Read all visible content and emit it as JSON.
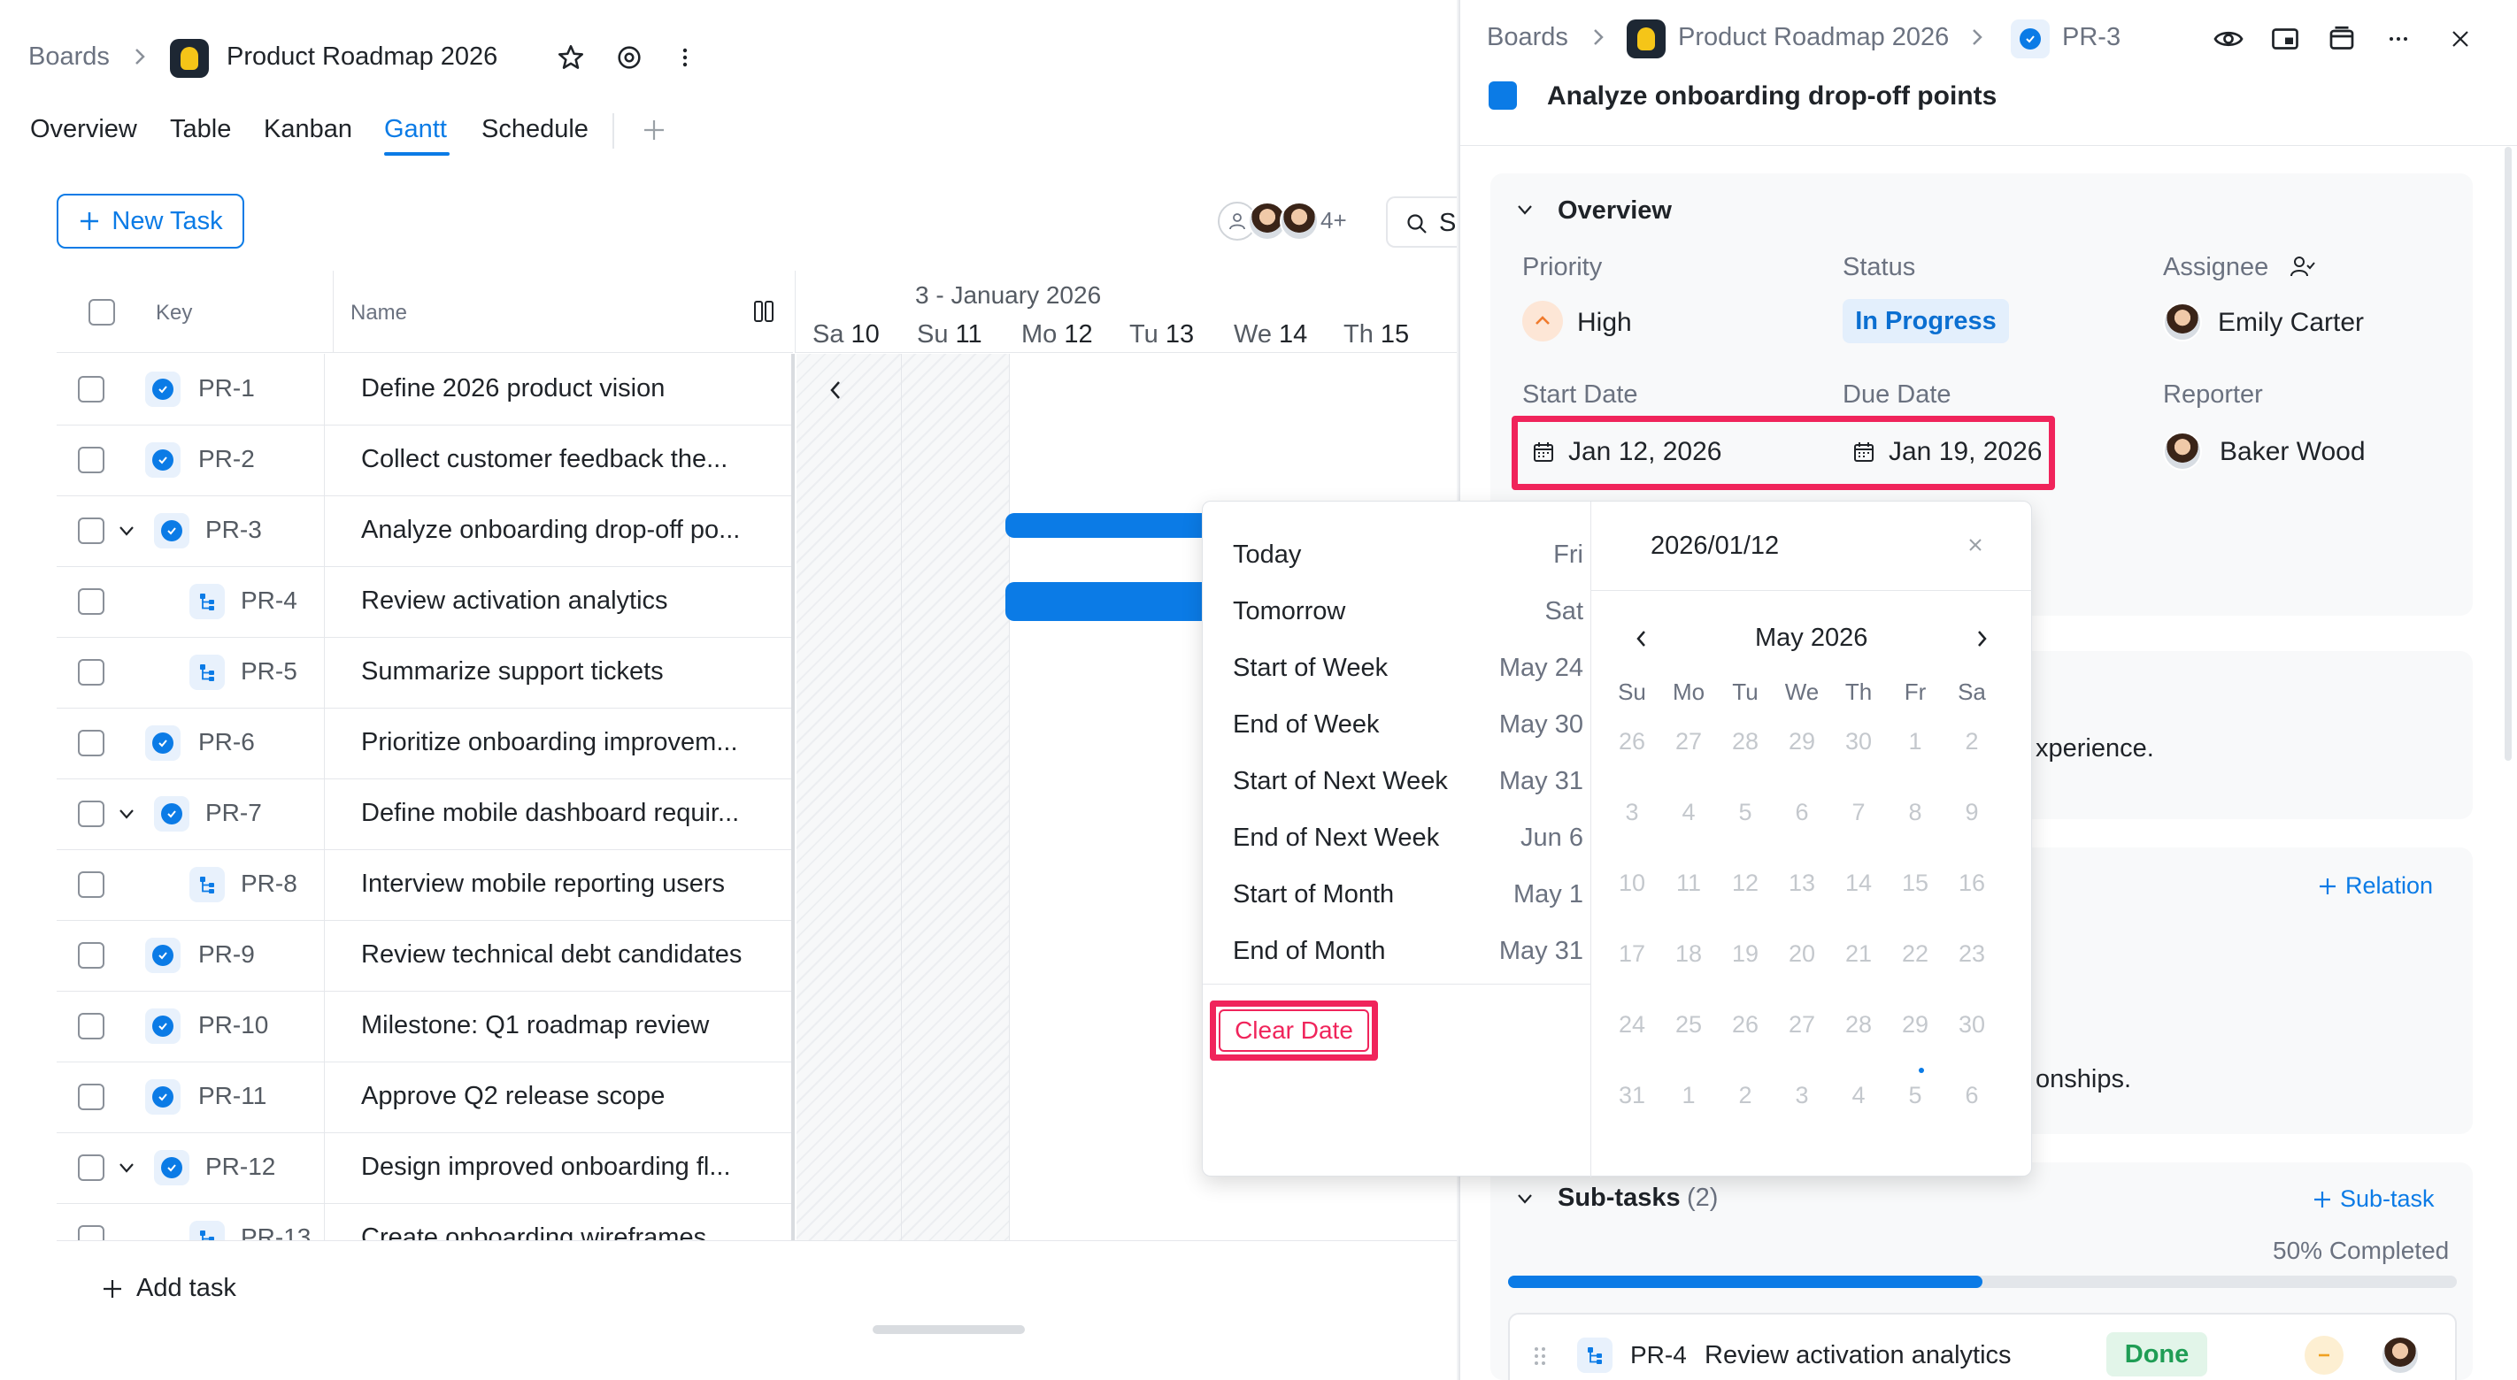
{
  "breadcrumb": {
    "boards": "Boards",
    "project": "Product Roadmap 2026",
    "task_key": "PR-3"
  },
  "tabs": [
    "Overview",
    "Table",
    "Kanban",
    "Gantt",
    "Schedule"
  ],
  "active_tab": "Gantt",
  "toolbar": {
    "new_task": "New Task",
    "members_more": "4+",
    "search_partial": "S"
  },
  "table": {
    "headers": {
      "key": "Key",
      "name": "Name"
    },
    "rows": [
      {
        "key": "PR-1",
        "name": "Define 2026 product vision",
        "type": "task",
        "expandable": false
      },
      {
        "key": "PR-2",
        "name": "Collect customer feedback the...",
        "type": "task",
        "expandable": false
      },
      {
        "key": "PR-3",
        "name": "Analyze onboarding drop-off po...",
        "type": "task",
        "expandable": true
      },
      {
        "key": "PR-4",
        "name": "Review activation analytics",
        "type": "subtask",
        "expandable": false
      },
      {
        "key": "PR-5",
        "name": "Summarize support tickets",
        "type": "subtask",
        "expandable": false
      },
      {
        "key": "PR-6",
        "name": "Prioritize onboarding improvem...",
        "type": "task",
        "expandable": false
      },
      {
        "key": "PR-7",
        "name": "Define mobile dashboard requir...",
        "type": "task",
        "expandable": true
      },
      {
        "key": "PR-8",
        "name": "Interview mobile reporting users",
        "type": "subtask",
        "expandable": false
      },
      {
        "key": "PR-9",
        "name": "Review technical debt candidates",
        "type": "task",
        "expandable": false
      },
      {
        "key": "PR-10",
        "name": "Milestone: Q1 roadmap review",
        "type": "task",
        "expandable": false
      },
      {
        "key": "PR-11",
        "name": "Approve Q2 release scope",
        "type": "task",
        "expandable": false
      },
      {
        "key": "PR-12",
        "name": "Design improved onboarding fl...",
        "type": "task",
        "expandable": true
      },
      {
        "key": "PR-13",
        "name": "Create onboarding wireframes",
        "type": "subtask",
        "expandable": false
      }
    ],
    "add_task": "Add task"
  },
  "gantt": {
    "week_label": "3 - January 2026",
    "days": [
      {
        "dow": "Sa",
        "num": "10"
      },
      {
        "dow": "Su",
        "num": "11"
      },
      {
        "dow": "Mo",
        "num": "12"
      },
      {
        "dow": "Tu",
        "num": "13"
      },
      {
        "dow": "We",
        "num": "14"
      },
      {
        "dow": "Th",
        "num": "15"
      }
    ]
  },
  "detail": {
    "title": "Analyze onboarding drop-off points",
    "overview_label": "Overview",
    "priority_label": "Priority",
    "priority_value": "High",
    "status_label": "Status",
    "status_value": "In Progress",
    "assignee_label": "Assignee",
    "assignee_value": "Emily Carter",
    "start_label": "Start Date",
    "start_value": "Jan 12, 2026",
    "due_label": "Due Date",
    "due_value": "Jan 19, 2026",
    "reporter_label": "Reporter",
    "reporter_value": "Baker Wood",
    "desc_fragment": "xperience.",
    "relation_button": "Relation",
    "relations_fragment": "onships.",
    "subtasks_label": "Sub-tasks",
    "subtasks_count": "(2)",
    "subtask_add": "Sub-task",
    "progress_text": "50% Completed",
    "progress": 0.5,
    "subtask_row": {
      "key": "PR-4",
      "name": "Review activation analytics",
      "status": "Done"
    }
  },
  "date_picker": {
    "input_value": "2026/01/12",
    "month_label": "May 2026",
    "clear_label": "Clear Date",
    "quick": [
      {
        "label": "Today",
        "value": "Fri"
      },
      {
        "label": "Tomorrow",
        "value": "Sat"
      },
      {
        "label": "Start of Week",
        "value": "May 24"
      },
      {
        "label": "End of Week",
        "value": "May 30"
      },
      {
        "label": "Start of Next Week",
        "value": "May 31"
      },
      {
        "label": "End of Next Week",
        "value": "Jun 6"
      },
      {
        "label": "Start of Month",
        "value": "May 1"
      },
      {
        "label": "End of Month",
        "value": "May 31"
      }
    ],
    "weekdays": [
      "Su",
      "Mo",
      "Tu",
      "We",
      "Th",
      "Fr",
      "Sa"
    ],
    "weeks": [
      [
        "26",
        "27",
        "28",
        "29",
        "30",
        "1",
        "2"
      ],
      [
        "3",
        "4",
        "5",
        "6",
        "7",
        "8",
        "9"
      ],
      [
        "10",
        "11",
        "12",
        "13",
        "14",
        "15",
        "16"
      ],
      [
        "17",
        "18",
        "19",
        "20",
        "21",
        "22",
        "23"
      ],
      [
        "24",
        "25",
        "26",
        "27",
        "28",
        "29",
        "30"
      ],
      [
        "31",
        "1",
        "2",
        "3",
        "4",
        "5",
        "6"
      ]
    ]
  },
  "colors": {
    "accent": "#0b7be6",
    "highlight": "#f0245b",
    "done_green": "#1f9d55",
    "priority_orange": "#f07a2c"
  }
}
